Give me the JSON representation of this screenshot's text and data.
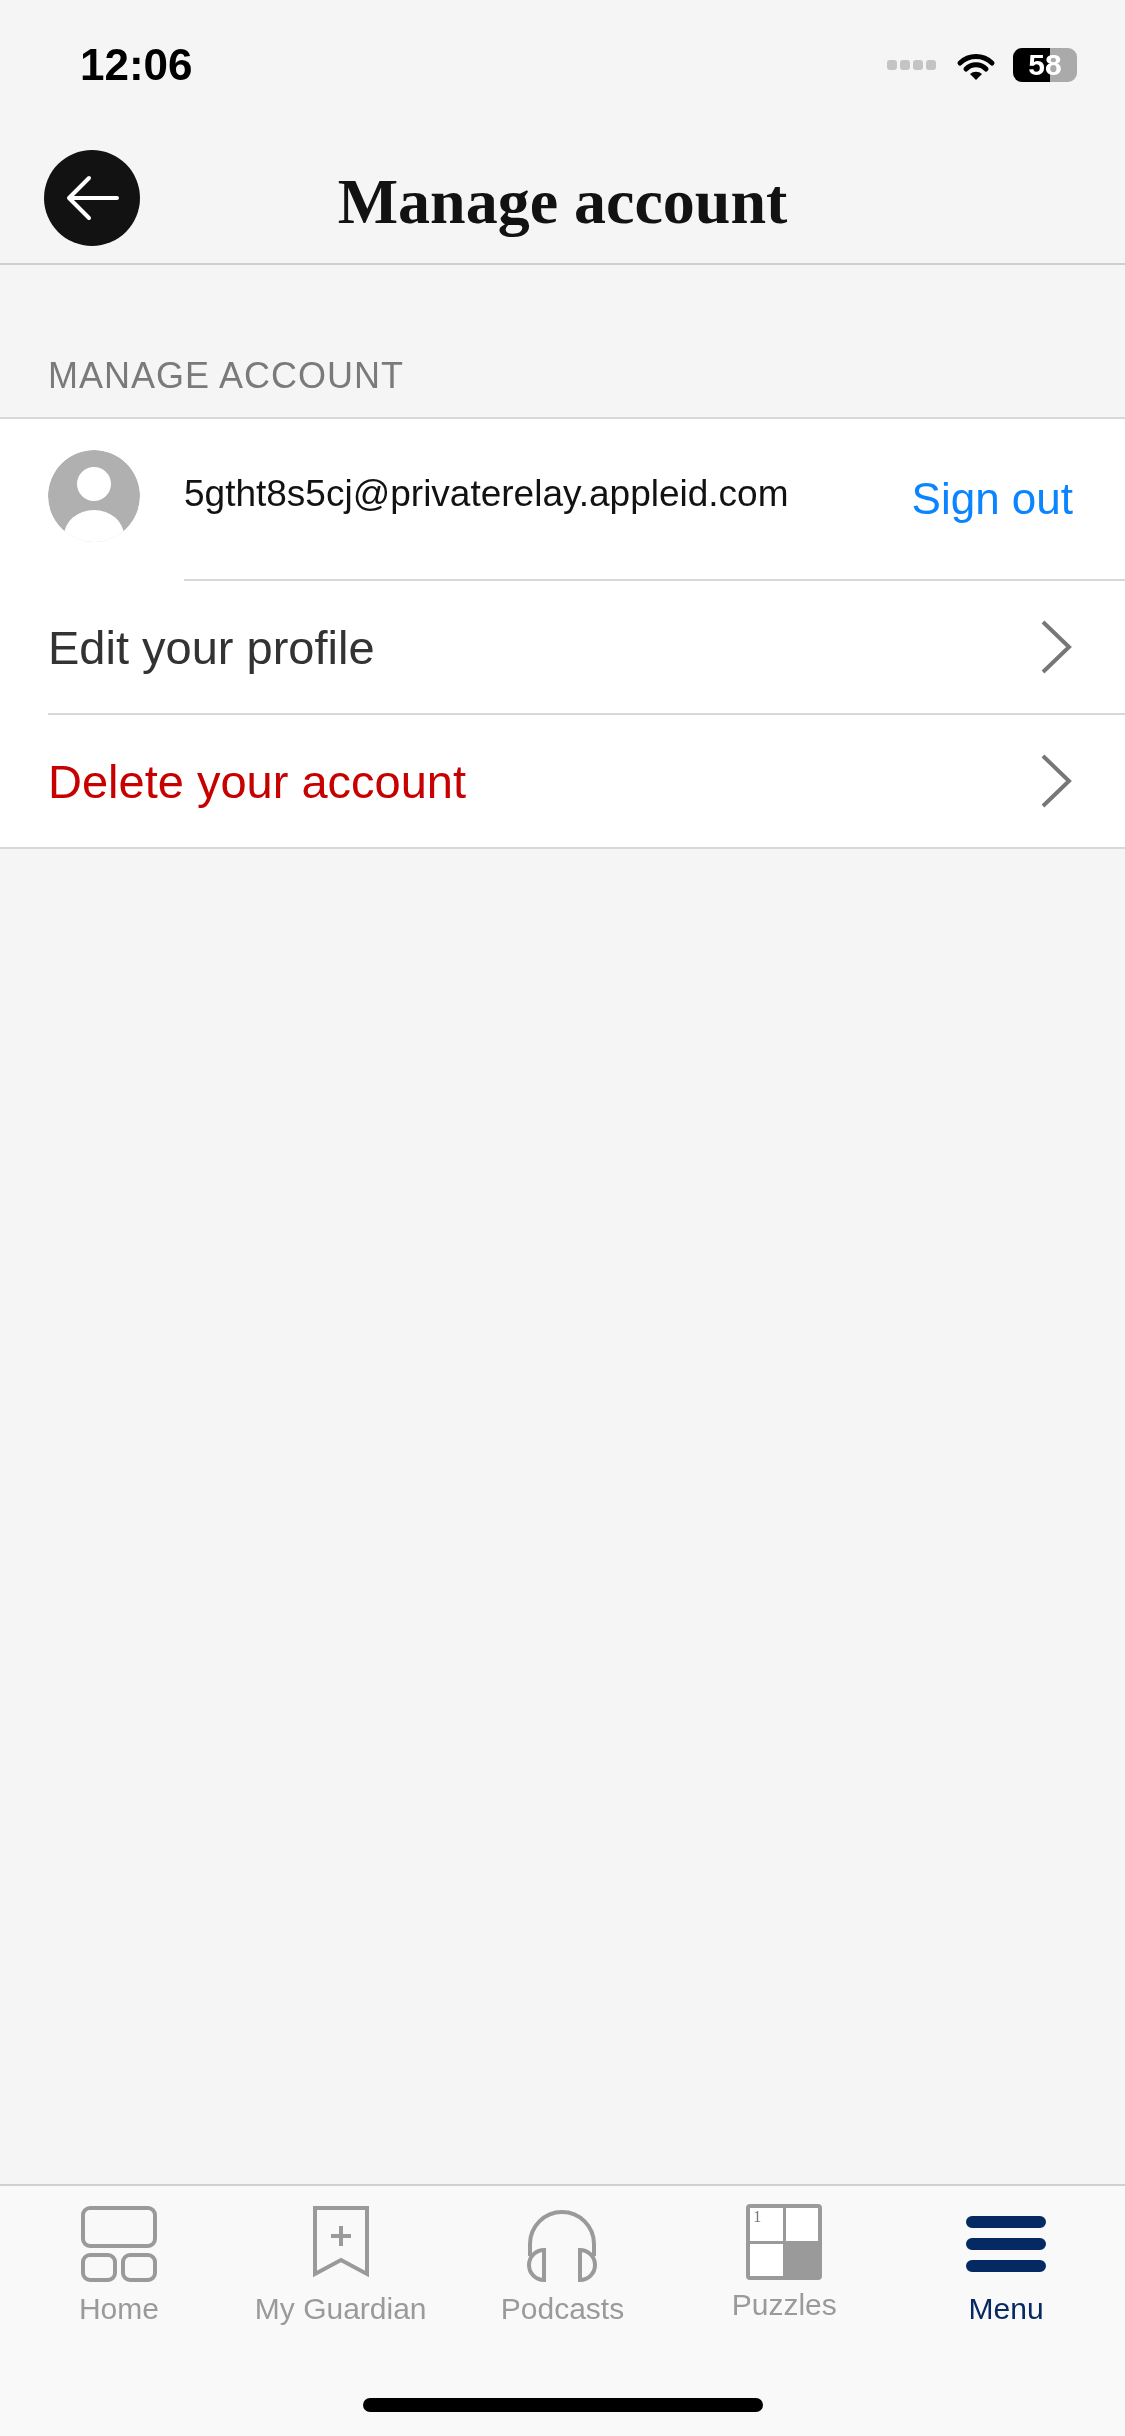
{
  "status_bar": {
    "time": "12:06",
    "battery": "58"
  },
  "header": {
    "title": "Manage account"
  },
  "section": {
    "title": "MANAGE ACCOUNT"
  },
  "rows": [
    {
      "kind": "account",
      "email": "5gtht8s5cj@privaterelay.appleid.com",
      "action": "Sign out"
    },
    {
      "kind": "link",
      "label": "Edit your profile",
      "destructive": false
    },
    {
      "kind": "link",
      "label": "Delete your account",
      "destructive": true
    }
  ],
  "tabs": [
    {
      "kind": "home",
      "label": "Home",
      "selected": false
    },
    {
      "kind": "bookmark",
      "label": "My Guardian",
      "selected": false
    },
    {
      "kind": "headphones",
      "label": "Podcasts",
      "selected": false
    },
    {
      "kind": "grid",
      "label": "Puzzles",
      "grid_number": "1",
      "selected": false
    },
    {
      "kind": "menu",
      "label": "Menu",
      "selected": true
    }
  ]
}
